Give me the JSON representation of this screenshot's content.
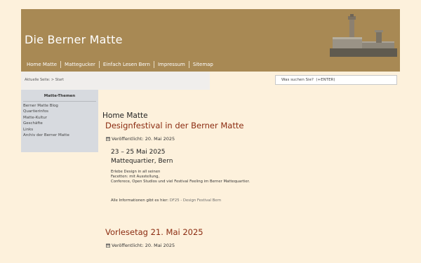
{
  "header": {
    "site_title": "Die Berner Matte",
    "nav": [
      "Home Matte",
      "Mattegucker",
      "Einfach Lesen Bern",
      "Impressum",
      "Sitemap"
    ],
    "image_subject": "fountain"
  },
  "breadcrumb": {
    "text": "Aktuelle Seite: > Start"
  },
  "search": {
    "placeholder": "Was suchen Sie?  (+ENTER)"
  },
  "sidebar": {
    "title": "Matte-Themen",
    "items": [
      "Berner Matte Blog",
      "Quartierinfos",
      "Matte-Kultur",
      "Geschäfte",
      "Links",
      "Archiv der Berner Matte"
    ]
  },
  "main": {
    "heading": "Home Matte",
    "articles": [
      {
        "title": "Designfestival in der Berner Matte",
        "published": "Veröffentlicht: 20. Mai 2025",
        "sub1": "23 – 25 Mai 2025",
        "sub2": "Mattequartier, Bern",
        "lines": [
          "Erlebe Design in all seinen",
          "Facetten: mit Ausstellung,",
          "Conferece, Open Studios und viel Festival Feeling im Berner Mattequartier."
        ],
        "link_prefix": "Alle Informationen gibt es hier: ",
        "link_text": "DF25 - Design Festival Bern"
      },
      {
        "title": "Vorlesetag 21. Mai 2025",
        "published": "Veröffentlicht: 20. Mai 2025"
      }
    ]
  },
  "colors": {
    "header_bg": "#a88954",
    "page_bg": "#fdf1dc",
    "title_red": "#8b2b10",
    "sidebar_bg": "#d7dadf"
  }
}
